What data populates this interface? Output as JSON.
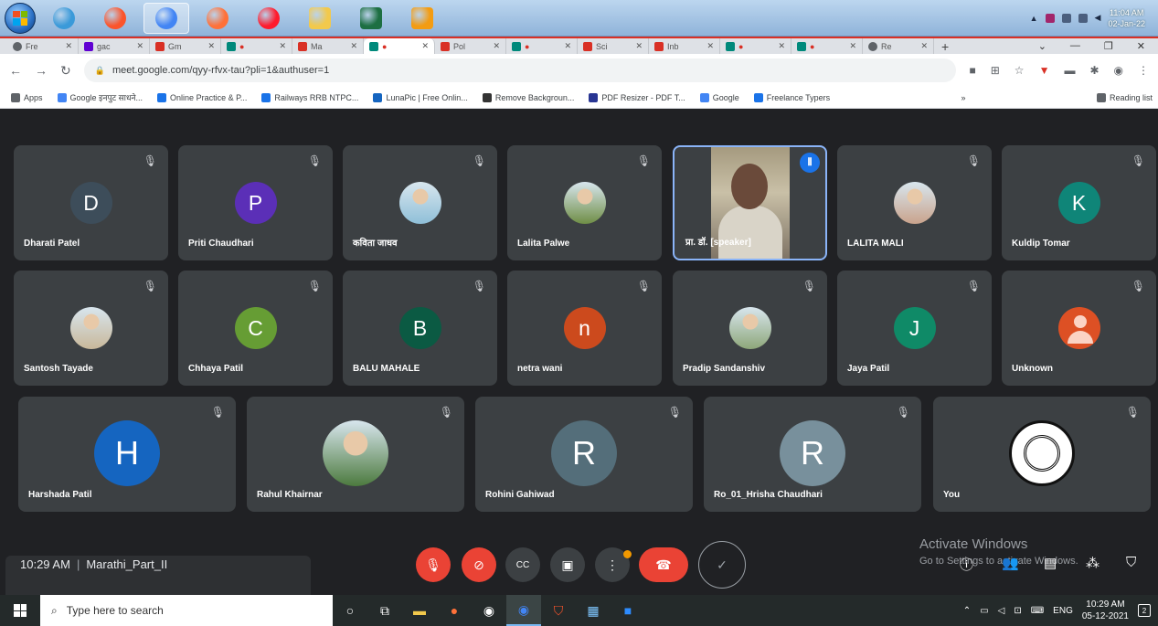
{
  "os_taskbar_top": {
    "apps": [
      {
        "name": "internet-explorer",
        "color": "#3a9ad9"
      },
      {
        "name": "brave",
        "color": "#fb542b"
      },
      {
        "name": "chrome",
        "color": "#4285f4"
      },
      {
        "name": "firefox",
        "color": "#ff7139"
      },
      {
        "name": "opera",
        "color": "#ff1b2d"
      },
      {
        "name": "file-explorer",
        "color": "#f2c94c"
      },
      {
        "name": "excel",
        "color": "#1d6f42"
      },
      {
        "name": "glary-utilities",
        "color": "#f39c12"
      }
    ],
    "clock_time": "11:04 AM",
    "clock_date": "02-Jan-22"
  },
  "browser": {
    "tabs": [
      {
        "label": "Fre",
        "icon": "globe"
      },
      {
        "label": "gac",
        "icon": "yahoo"
      },
      {
        "label": "Gm",
        "icon": "gmail"
      },
      {
        "label": "",
        "icon": "meet"
      },
      {
        "label": "Ma",
        "icon": "gmail"
      },
      {
        "label": "",
        "icon": "meet"
      },
      {
        "label": "Pol",
        "icon": "gmail"
      },
      {
        "label": "",
        "icon": "meet"
      },
      {
        "label": "Sci",
        "icon": "gmail"
      },
      {
        "label": "Inb",
        "icon": "gmail"
      },
      {
        "label": "",
        "icon": "meet"
      },
      {
        "label": "",
        "icon": "meet"
      },
      {
        "label": "Re",
        "icon": "globe"
      }
    ],
    "url": "meet.google.com/qyy-rfvx-tau?pli=1&authuser=1",
    "bookmarks": [
      "Apps",
      "Google इनपुट साधने...",
      "Online Practice & P...",
      "Railways RRB NTPC...",
      "LunaPic | Free Onlin...",
      "Remove Backgroun...",
      "PDF Resizer - PDF T...",
      "Google",
      "Freelance Typers"
    ],
    "reading_list": "Reading list"
  },
  "meet": {
    "participants": [
      {
        "name": "Dharati Patel",
        "initial": "D",
        "color": "#3d4d5a",
        "type": "letter"
      },
      {
        "name": "Priti Chaudhari",
        "initial": "P",
        "color": "#5b2fb7",
        "type": "letter"
      },
      {
        "name": "कविता जाधव",
        "initial": "",
        "color": "#8fbfd8",
        "type": "photo"
      },
      {
        "name": "Lalita Palwe",
        "initial": "",
        "color": "#6f8e46",
        "type": "photo"
      },
      {
        "name": "प्रा. डॉ. [speaker]",
        "initial": "",
        "color": "#9c8f78",
        "type": "video"
      },
      {
        "name": "LALITA MALI",
        "initial": "",
        "color": "#c9a38c",
        "type": "photo"
      },
      {
        "name": "Kuldip Tomar",
        "initial": "K",
        "color": "#0f8578",
        "type": "letter"
      },
      {
        "name": "Santosh Tayade",
        "initial": "",
        "color": "#c8b89a",
        "type": "photo"
      },
      {
        "name": "Chhaya Patil",
        "initial": "C",
        "color": "#669d34",
        "type": "letter"
      },
      {
        "name": "BALU MAHALE",
        "initial": "B",
        "color": "#0b5a43",
        "type": "letter"
      },
      {
        "name": "netra wani",
        "initial": "n",
        "color": "#cc4a1d",
        "type": "letter"
      },
      {
        "name": "Pradip Sandanshiv",
        "initial": "",
        "color": "#8ea77a",
        "type": "photo"
      },
      {
        "name": "Jaya Patil",
        "initial": "J",
        "color": "#0f8a67",
        "type": "letter"
      },
      {
        "name": "Unknown",
        "initial": "",
        "color": "#dd5024",
        "type": "person"
      },
      {
        "name": "Harshada Patil",
        "initial": "H",
        "color": "#1565c0",
        "type": "letter"
      },
      {
        "name": "Rahul Khairnar",
        "initial": "",
        "color": "#4c7a3e",
        "type": "photo"
      },
      {
        "name": "Rohini Gahiwad",
        "initial": "R",
        "color": "#546e7a",
        "type": "letter"
      },
      {
        "name": "Ro_01_Hrisha Chaudhari",
        "initial": "R",
        "color": "#78909c",
        "type": "letter"
      },
      {
        "name": "You",
        "initial": "",
        "color": "#ffffff",
        "type": "emblem"
      }
    ],
    "meeting_time": "10:29 AM",
    "meeting_name": "Marathi_Part_II",
    "watermark_line1": "Activate Windows",
    "watermark_line2": "Go to Settings to activate Windows."
  },
  "win10_taskbar": {
    "search_placeholder": "Type here to search",
    "language": "ENG",
    "clock_time": "10:29 AM",
    "clock_date": "05-12-2021"
  }
}
